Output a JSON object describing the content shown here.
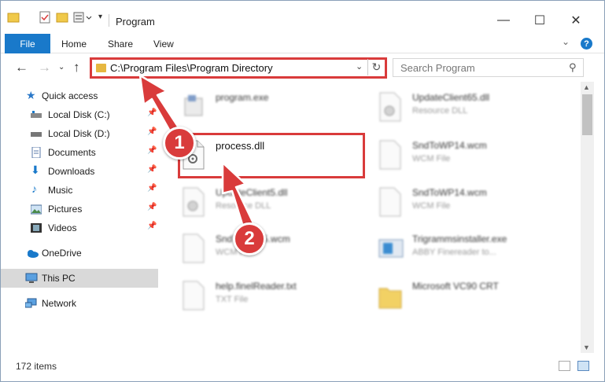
{
  "window": {
    "title": "Program"
  },
  "ribbon": {
    "file": "File",
    "home": "Home",
    "share": "Share",
    "view": "View",
    "help": "?"
  },
  "nav": {
    "address": "C:\\Program Files\\Program Directory",
    "search_placeholder": "Search Program"
  },
  "sidebar": {
    "items": [
      {
        "label": "Quick access",
        "icon": "star-icon",
        "pinned": false
      },
      {
        "label": "Local Disk (C:)",
        "icon": "drive-icon",
        "pinned": true
      },
      {
        "label": "Local Disk (D:)",
        "icon": "drive-icon",
        "pinned": true
      },
      {
        "label": "Documents",
        "icon": "documents-icon",
        "pinned": true
      },
      {
        "label": "Downloads",
        "icon": "download-icon",
        "pinned": true
      },
      {
        "label": "Music",
        "icon": "music-icon",
        "pinned": true
      },
      {
        "label": "Pictures",
        "icon": "pictures-icon",
        "pinned": true
      },
      {
        "label": "Videos",
        "icon": "videos-icon",
        "pinned": true
      },
      {
        "label": "OneDrive",
        "icon": "cloud-icon",
        "pinned": false
      },
      {
        "label": "This PC",
        "icon": "computer-icon",
        "pinned": false,
        "selected": true
      },
      {
        "label": "Network",
        "icon": "network-icon",
        "pinned": false
      }
    ]
  },
  "files": [
    {
      "name": "program.exe",
      "type": "",
      "icon": "exe-icon"
    },
    {
      "name": "UpdateClient65.dll",
      "type": "Resource DLL",
      "icon": "dll-icon"
    },
    {
      "name": "process.dll",
      "type": "",
      "icon": "dll-icon",
      "highlighted": true
    },
    {
      "name": "SndToWP14.wcm",
      "type": "WCM File",
      "icon": "file-icon"
    },
    {
      "name": "UpdateClient5.dll",
      "type": "Resource DLL",
      "icon": "dll-icon"
    },
    {
      "name": "SndToWP14.wcm",
      "type": "WCM File",
      "icon": "file-icon"
    },
    {
      "name": "SndToWP15.wcm",
      "type": "WCM File",
      "icon": "file-icon"
    },
    {
      "name": "Trigrammsinstaller.exe",
      "type": "ABBY Finereader to...",
      "icon": "installer-icon"
    },
    {
      "name": "help.finelReader.txt",
      "type": "TXT File",
      "icon": "file-icon"
    },
    {
      "name": "Microsoft VC90 CRT",
      "type": "",
      "icon": "folder-icon"
    }
  ],
  "status": {
    "count": "172 items"
  },
  "annotations": {
    "step1": "1",
    "step2": "2",
    "color": "#d93b3b"
  }
}
